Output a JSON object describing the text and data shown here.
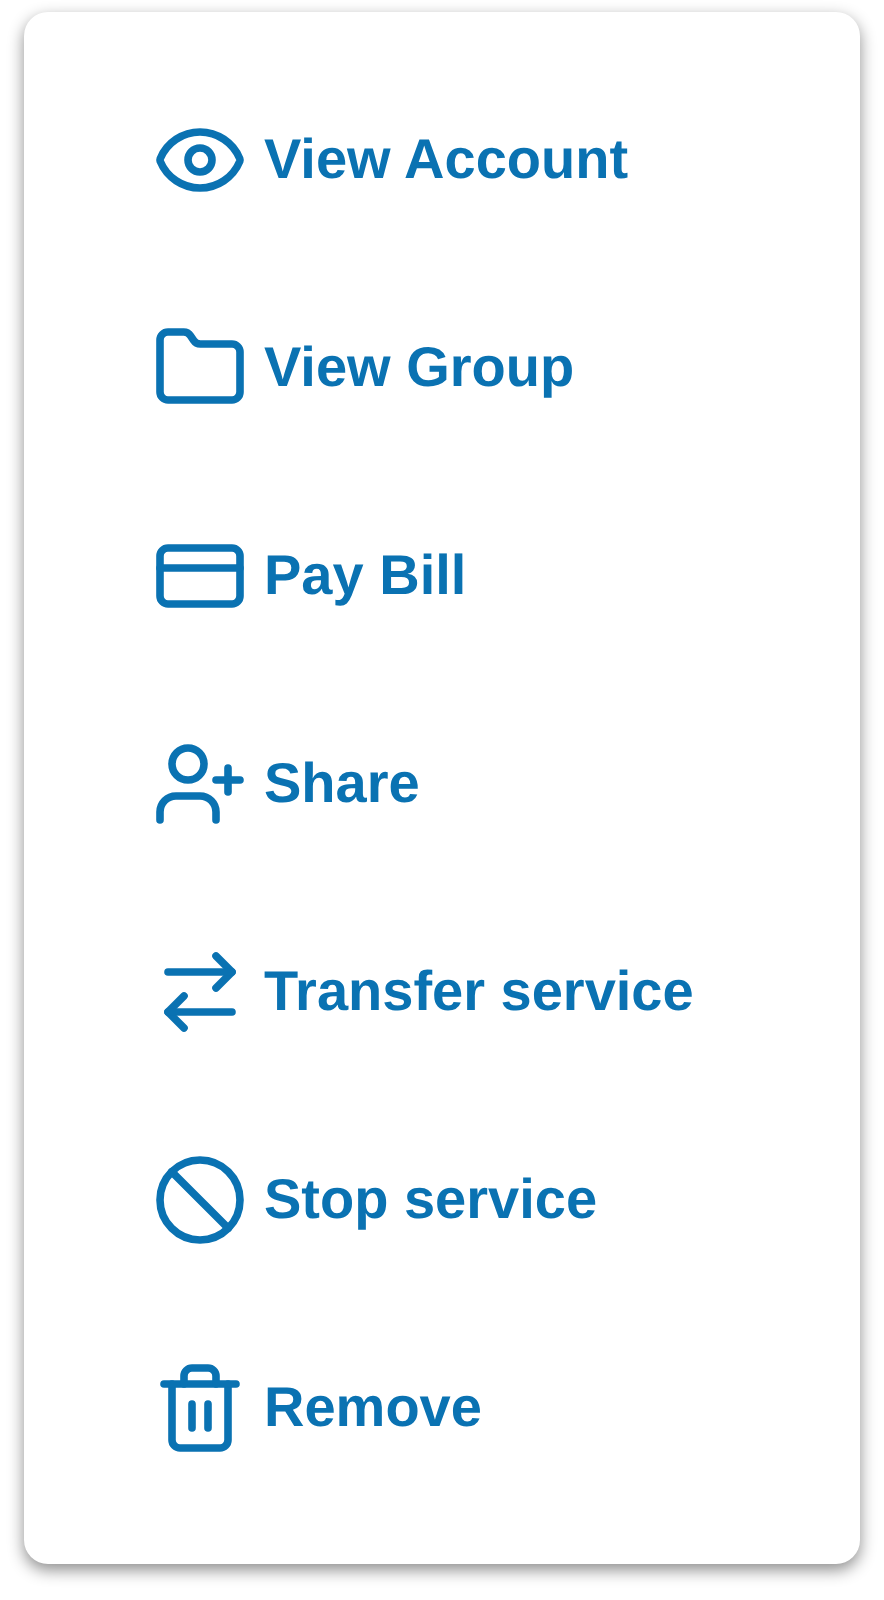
{
  "menu": {
    "items": [
      {
        "kind": "account",
        "label": "View Account"
      },
      {
        "kind": "group",
        "label": "View Group"
      },
      {
        "kind": "bill",
        "label": "Pay Bill"
      },
      {
        "kind": "share",
        "label": "Share"
      },
      {
        "kind": "transfer",
        "label": "Transfer service"
      },
      {
        "kind": "stop",
        "label": "Stop service"
      },
      {
        "kind": "remove",
        "label": "Remove"
      }
    ]
  }
}
